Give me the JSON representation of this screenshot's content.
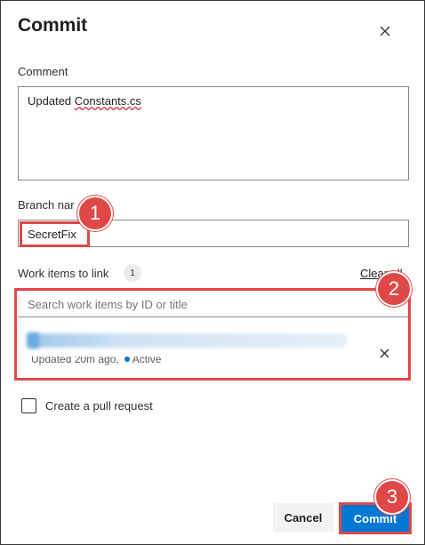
{
  "dialog": {
    "title": "Commit",
    "comment_label": "Comment",
    "comment_value_prefix": "Updated ",
    "comment_value_spellcheck_word": "Constants.cs",
    "branch_label": "Branch nar",
    "branch_value": "SecretFix",
    "work_items_label": "Work items to link",
    "work_items_count": "1",
    "clear_all": "Clear all",
    "search_placeholder": "Search work items by ID or title",
    "work_item": {
      "meta_updated": "Updated 20m ago,",
      "meta_state": "Active"
    },
    "pull_request_label": "Create a pull request",
    "cancel_label": "Cancel",
    "commit_label": "Commit"
  },
  "callouts": [
    "1",
    "2",
    "3"
  ],
  "colors": {
    "accent": "#0078d4",
    "highlight": "#e04848"
  },
  "icons": {
    "close": "close-icon",
    "chevron": "chevron-down-icon",
    "remove": "close-icon"
  }
}
